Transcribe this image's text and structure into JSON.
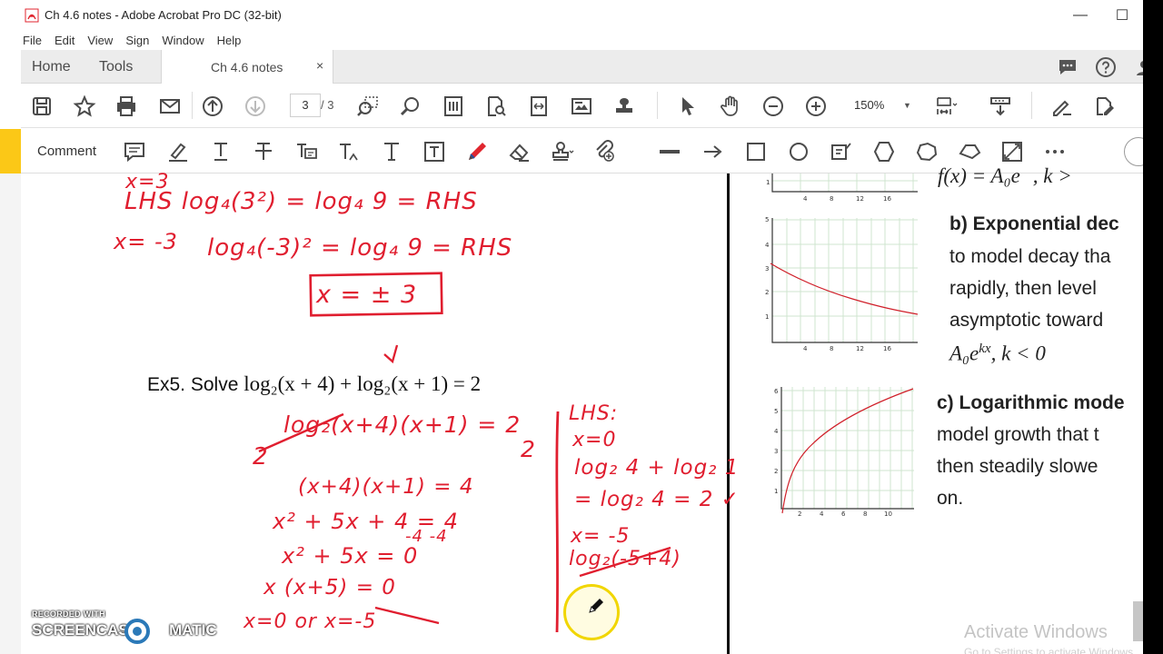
{
  "window": {
    "title": "Ch 4.6 notes - Adobe Acrobat Pro DC (32-bit)"
  },
  "menu": [
    "File",
    "Edit",
    "View",
    "Sign",
    "Window",
    "Help"
  ],
  "tabs": {
    "home": "Home",
    "tools": "Tools",
    "doc": "Ch 4.6 notes",
    "close": "×"
  },
  "toolbar": {
    "page_current": "3",
    "page_total": "/ 3",
    "zoom": "150%"
  },
  "commentbar": {
    "label": "Comment"
  },
  "doc": {
    "ex5_label": "Ex5.  Solve ",
    "ex5_math": "log₂(x + 4) + log₂(x + 1) = 2",
    "handwriting": {
      "l1": "x=3",
      "l2": "LHS  log₄(3²) = log₄ 9  = RHS",
      "l3": "x= -3",
      "l4": "log₄(-3)² = log₄ 9  = RHS",
      "l5": "x = ± 3",
      "w1": "log₂(x+4)(x+1) = 2",
      "w1b": "2",
      "w1c": "2",
      "w2": "(x+4)(x+1) = 4",
      "w3": "x² + 5x + 4 = 4",
      "w3b": "-4      -4",
      "w4": "x² + 5x  = 0",
      "w5": "x (x+5) = 0",
      "w6": "x=0     or x=-5",
      "c1": "LHS:",
      "c2": "x=0",
      "c3": "log₂ 4 + log₂ 1",
      "c4": "= log₂ 4 = 2 ✓",
      "c5": "x= -5",
      "c6": "log₂(-5+4)"
    },
    "right": {
      "top_math": "f(x) = A₀e",
      "top_math2": ", k >",
      "b_head": "b) Exponential dec",
      "b_l1": "to model decay tha",
      "b_l2": "rapidly, then level",
      "b_l3": "asymptotic toward",
      "b_math": "A₀e",
      "b_math_sup": "kx",
      "b_math2": ", k < 0",
      "c_head": "c) Logarithmic mode",
      "c_l1": "model growth that t",
      "c_l2": "then steadily slowe",
      "c_l3": "on.",
      "g1_xt": [
        "4",
        "8",
        "12",
        "16"
      ],
      "g2_yt": [
        "1",
        "2",
        "3",
        "4",
        "5"
      ],
      "g3_xt": [
        "2",
        "4",
        "6",
        "8",
        "10"
      ],
      "g3_yt": [
        "1",
        "2",
        "3",
        "4",
        "5",
        "6"
      ]
    }
  },
  "watermark": {
    "l1": "Activate Windows",
    "l2": "Go to Settings to activate Windows."
  },
  "recorder": {
    "l1": "RECORDED WITH",
    "l2a": "SCREENCAST",
    "l2b": "MATIC"
  }
}
